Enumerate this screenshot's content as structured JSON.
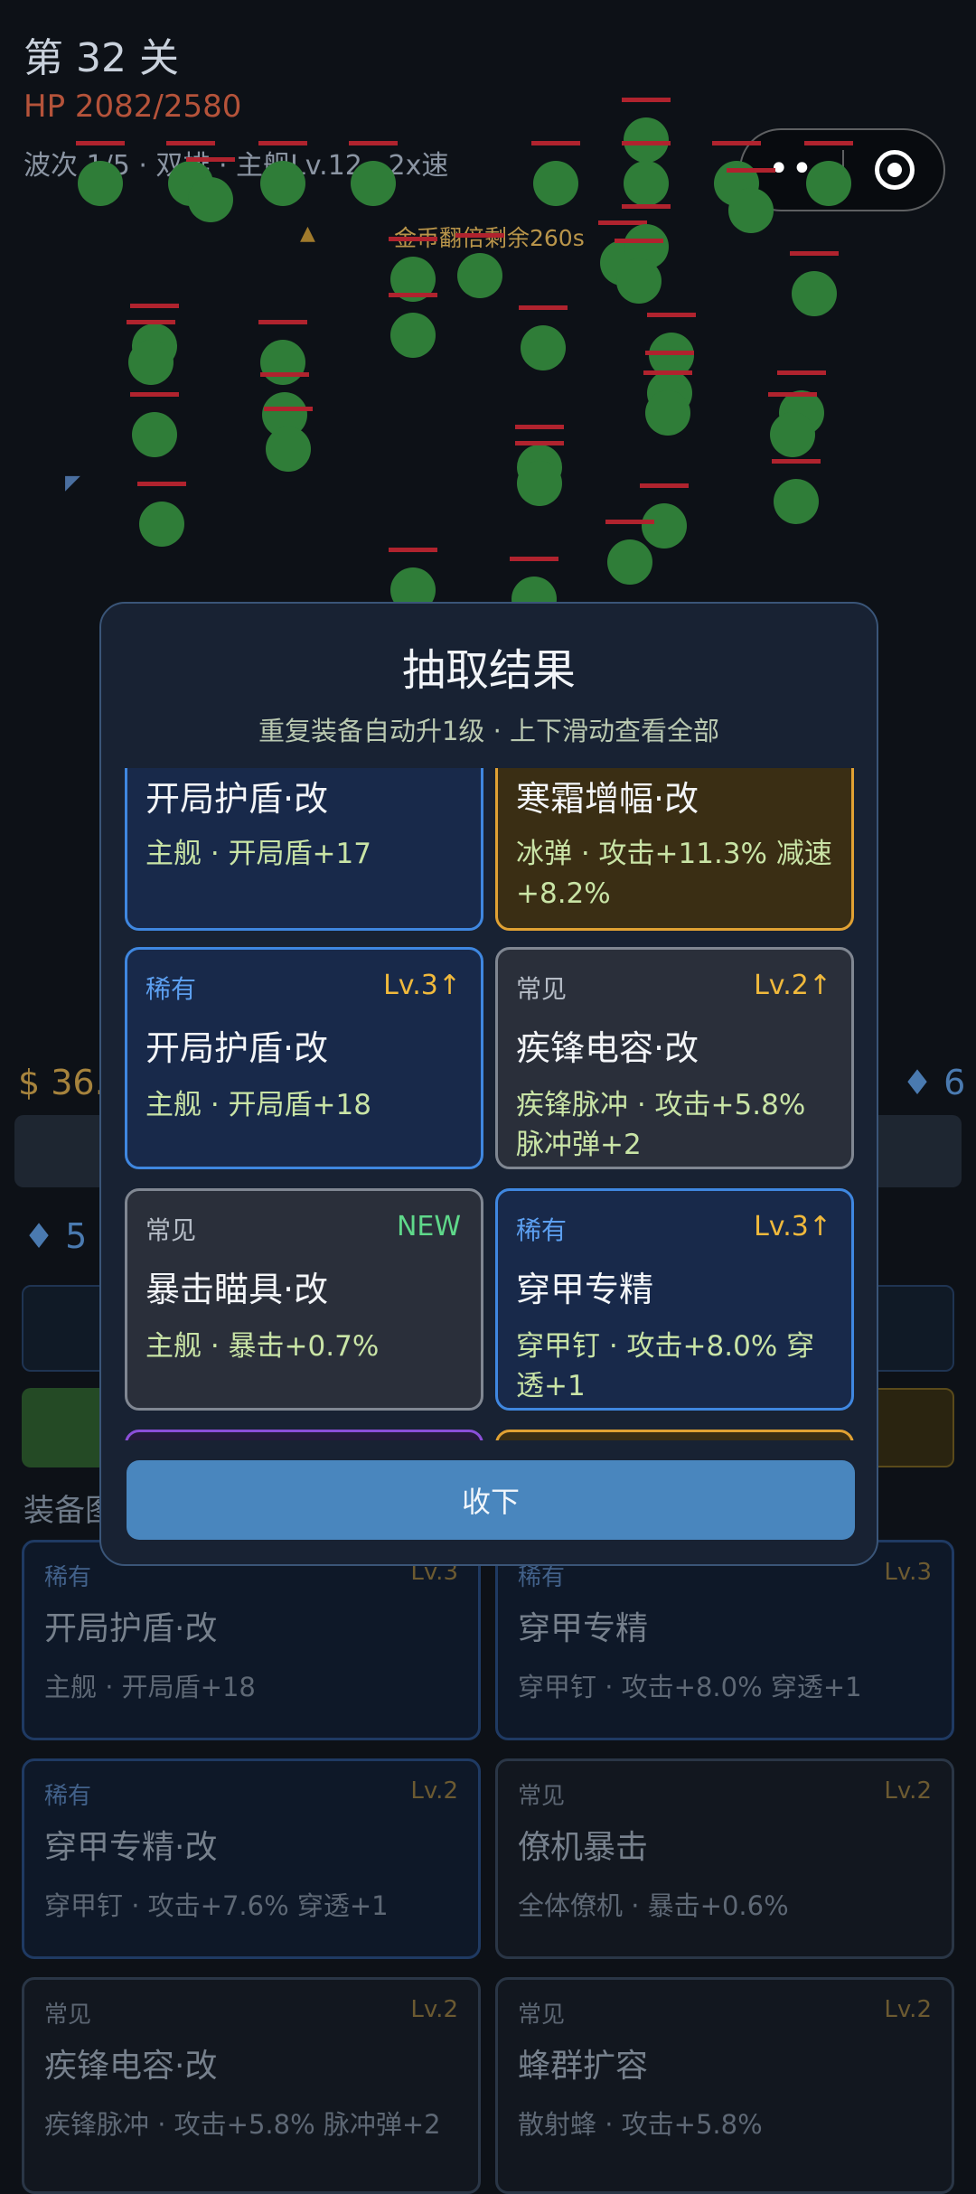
{
  "hud": {
    "level": "第 32 关",
    "hp": "HP 2082/2580",
    "wave": "波次 1/5 · 双排 · 主舰Lv.12 · 2x速",
    "gold_timer": "金币翻倍剩余260s"
  },
  "bg": {
    "money": "$ 36.",
    "gem_right": "♦ 6",
    "gem_left": "♦ 5",
    "section_label": "装备图",
    "cards": [
      {
        "rarity": "稀有",
        "level": "Lv.3",
        "name": "开局护盾·改",
        "desc": "主舰 · 开局盾+18"
      },
      {
        "rarity": "稀有",
        "level": "Lv.3",
        "name": "穿甲专精",
        "desc": "穿甲钉 · 攻击+8.0% 穿透+1"
      },
      {
        "rarity": "稀有",
        "level": "Lv.2",
        "name": "穿甲专精·改",
        "desc": "穿甲钉 · 攻击+7.6% 穿透+1"
      },
      {
        "rarity": "常见",
        "level": "Lv.2",
        "name": "僚机暴击",
        "desc": "全体僚机 · 暴击+0.6%"
      },
      {
        "rarity": "常见",
        "level": "Lv.2",
        "name": "疾锋电容·改",
        "desc": "疾锋脉冲 · 攻击+5.8% 脉冲弹+2"
      },
      {
        "rarity": "常见",
        "level": "Lv.2",
        "name": "蜂群扩容",
        "desc": "散射蜂 · 攻击+5.8%"
      }
    ]
  },
  "modal": {
    "title": "抽取结果",
    "subtitle": "重复装备自动升1级 · 上下滑动查看全部",
    "collapse_label": "收下",
    "cards": [
      {
        "rarity": "",
        "level": "",
        "name": "开局护盾·改",
        "desc": "主舰 · 开局盾+17"
      },
      {
        "rarity": "",
        "level": "",
        "name": "寒霜增幅·改",
        "desc": "冰弹 · 攻击+11.3% 减速+8.2%"
      },
      {
        "rarity": "稀有",
        "level": "Lv.3↑",
        "name": "开局护盾·改",
        "desc": "主舰 · 开局盾+18"
      },
      {
        "rarity": "常见",
        "level": "Lv.2↑",
        "name": "疾锋电容·改",
        "desc": "疾锋脉冲 · 攻击+5.8% 脉冲弹+2"
      },
      {
        "rarity": "常见",
        "level": "NEW",
        "name": "暴击瞄具·改",
        "desc": "主舰 · 暴击+0.7%"
      },
      {
        "rarity": "稀有",
        "level": "Lv.3↑",
        "name": "穿甲专精",
        "desc": "穿甲钉 · 攻击+8.0% 穿透+1"
      }
    ]
  },
  "colors": {
    "rare_border": "#3f87e0",
    "epic_border": "#e0a133",
    "common_border": "#808792",
    "level_up": "#f0b93c",
    "new_tag": "#5fd88a",
    "button": "#4986be"
  }
}
